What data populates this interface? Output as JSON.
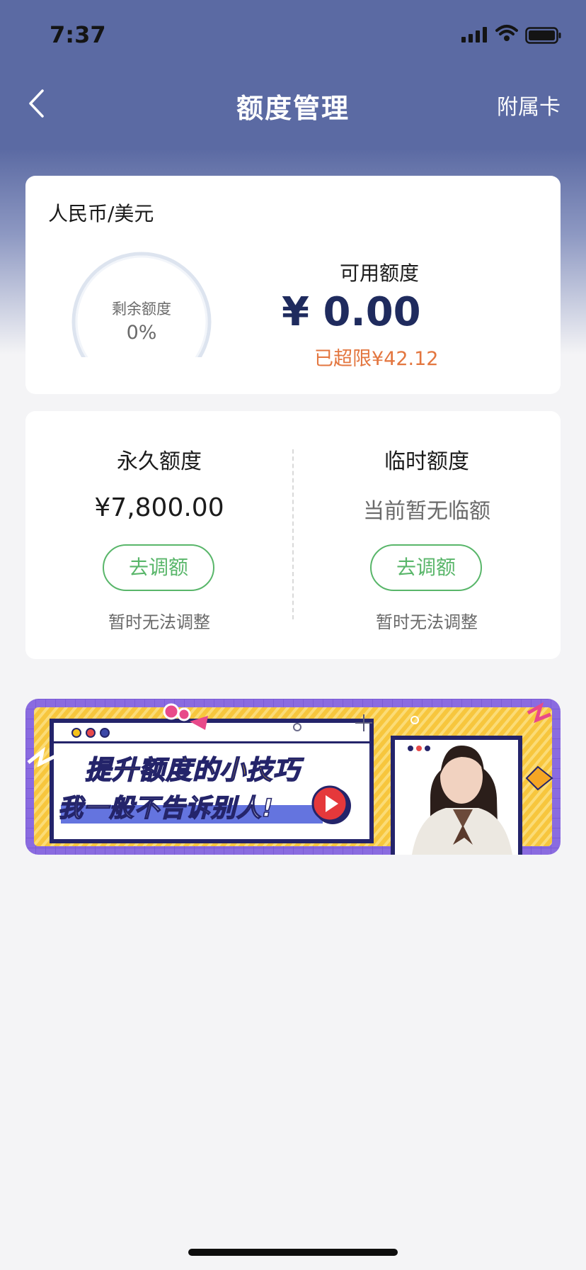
{
  "status_bar": {
    "time": "7:37"
  },
  "nav": {
    "title": "额度管理",
    "right_action": "附属卡"
  },
  "summary_card": {
    "currency": "人民币/美元",
    "ring_label": "剩余额度",
    "ring_value": "0%",
    "ring_fraction": 0,
    "available_label": "可用额度",
    "available_amount": "¥ 0.00",
    "over_limit": "已超限¥42.12"
  },
  "limits_card": {
    "permanent": {
      "title": "永久额度",
      "amount": "¥7,800.00",
      "button": "去调额",
      "note": "暂时无法调整"
    },
    "temporary": {
      "title": "临时额度",
      "amount": "当前暂无临额",
      "button": "去调额",
      "note": "暂时无法调整"
    }
  },
  "banner": {
    "line1": "提升额度的小技巧",
    "line2": "我一般不告诉别人!"
  },
  "colors": {
    "header": "#5b6aa3",
    "accent_green": "#59b66a",
    "warning_orange": "#e3763f",
    "amount_navy": "#1f2b5e"
  }
}
